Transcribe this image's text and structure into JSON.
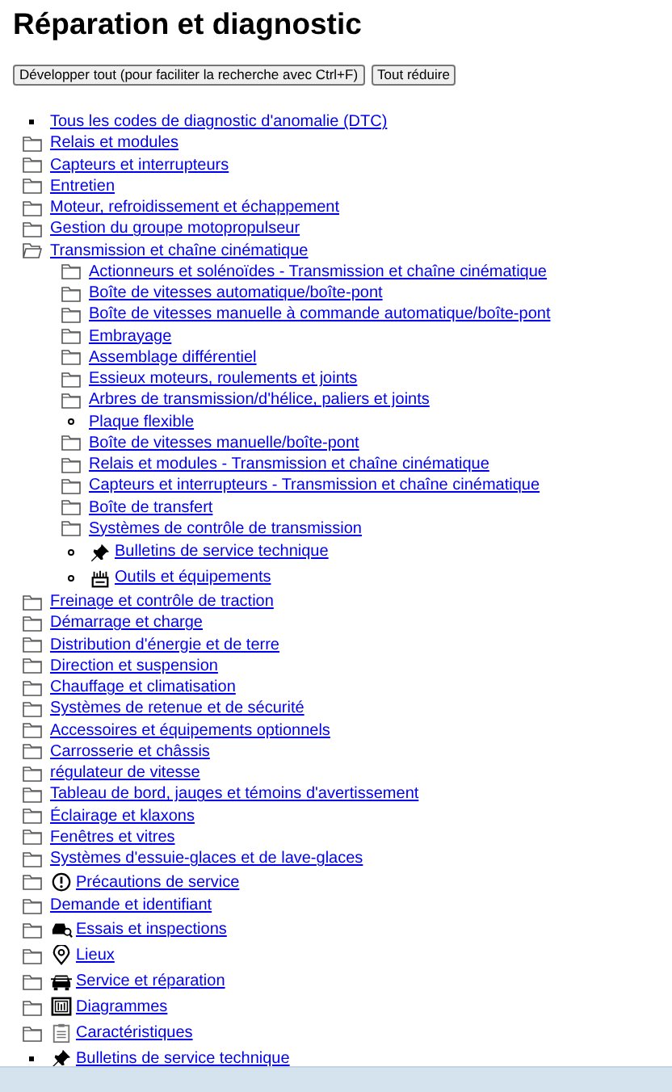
{
  "title": "Réparation et diagnostic",
  "buttons": [
    "Développer tout (pour faciliter la recherche avec Ctrl+F)",
    "Tout réduire"
  ],
  "tree": [
    {
      "kind": "item",
      "label": "Tous les codes de diagnostic d'anomalie (DTC)"
    },
    {
      "kind": "folder",
      "expanded": false,
      "label": "Relais et modules"
    },
    {
      "kind": "folder",
      "expanded": false,
      "label": "Capteurs et interrupteurs"
    },
    {
      "kind": "folder",
      "expanded": false,
      "label": "Entretien"
    },
    {
      "kind": "folder",
      "expanded": false,
      "label": "Moteur, refroidissement et échappement"
    },
    {
      "kind": "folder",
      "expanded": false,
      "label": "Gestion du groupe motopropulseur"
    },
    {
      "kind": "folder",
      "expanded": true,
      "label": "Transmission et chaîne cinématique",
      "children": [
        {
          "kind": "folder",
          "expanded": false,
          "label": "Actionneurs et solénoïdes - Transmission et chaîne cinématique"
        },
        {
          "kind": "folder",
          "expanded": false,
          "label": "Boîte de vitesses automatique/boîte-pont"
        },
        {
          "kind": "folder",
          "expanded": false,
          "label": "Boîte de vitesses manuelle à commande automatique/boîte-pont"
        },
        {
          "kind": "folder",
          "expanded": false,
          "label": "Embrayage"
        },
        {
          "kind": "folder",
          "expanded": false,
          "label": "Assemblage différentiel"
        },
        {
          "kind": "folder",
          "expanded": false,
          "label": "Essieux moteurs, roulements et joints"
        },
        {
          "kind": "folder",
          "expanded": false,
          "label": "Arbres de transmission/d'hélice, paliers et joints"
        },
        {
          "kind": "item",
          "label": "Plaque flexible"
        },
        {
          "kind": "folder",
          "expanded": false,
          "label": "Boîte de vitesses manuelle/boîte-pont"
        },
        {
          "kind": "folder",
          "expanded": false,
          "label": "Relais et modules - Transmission et chaîne cinématique"
        },
        {
          "kind": "folder",
          "expanded": false,
          "label": "Capteurs et interrupteurs - Transmission et chaîne cinématique"
        },
        {
          "kind": "folder",
          "expanded": false,
          "label": "Boîte de transfert"
        },
        {
          "kind": "folder",
          "expanded": false,
          "label": "Systèmes de contrôle de transmission"
        },
        {
          "kind": "item",
          "label": "Bulletins de service technique"
        },
        {
          "kind": "item",
          "label": "Outils et équipements"
        }
      ]
    },
    {
      "kind": "folder",
      "expanded": false,
      "label": "Freinage et contrôle de traction"
    },
    {
      "kind": "folder",
      "expanded": false,
      "label": "Démarrage et charge"
    },
    {
      "kind": "folder",
      "expanded": false,
      "label": "Distribution d'énergie et de terre"
    },
    {
      "kind": "folder",
      "expanded": false,
      "label": "Direction et suspension"
    },
    {
      "kind": "folder",
      "expanded": false,
      "label": "Chauffage et climatisation"
    },
    {
      "kind": "folder",
      "expanded": false,
      "label": "Systèmes de retenue et de sécurité"
    },
    {
      "kind": "folder",
      "expanded": false,
      "label": "Accessoires et équipements optionnels"
    },
    {
      "kind": "folder",
      "expanded": false,
      "label": "Carrosserie et châssis"
    },
    {
      "kind": "folder",
      "expanded": false,
      "label": "régulateur de vitesse"
    },
    {
      "kind": "folder",
      "expanded": false,
      "label": "Tableau de bord, jauges et témoins d'avertissement"
    },
    {
      "kind": "folder",
      "expanded": false,
      "label": "Éclairage et klaxons"
    },
    {
      "kind": "folder",
      "expanded": false,
      "label": "Fenêtres et vitres"
    },
    {
      "kind": "folder",
      "expanded": false,
      "label": "Systèmes d'essuie-glaces et de lave-glaces"
    },
    {
      "kind": "folder",
      "expanded": false,
      "label": "Précautions de service"
    },
    {
      "kind": "folder",
      "expanded": false,
      "label": "Demande et identifiant"
    },
    {
      "kind": "folder",
      "expanded": false,
      "label": "Essais et inspections"
    },
    {
      "kind": "folder",
      "expanded": false,
      "label": "Lieux"
    },
    {
      "kind": "folder",
      "expanded": false,
      "label": "Service et réparation"
    },
    {
      "kind": "folder",
      "expanded": false,
      "label": "Diagrammes"
    },
    {
      "kind": "folder",
      "expanded": false,
      "label": "Caractéristiques"
    },
    {
      "kind": "item",
      "label": "Bulletins de service technique"
    }
  ]
}
